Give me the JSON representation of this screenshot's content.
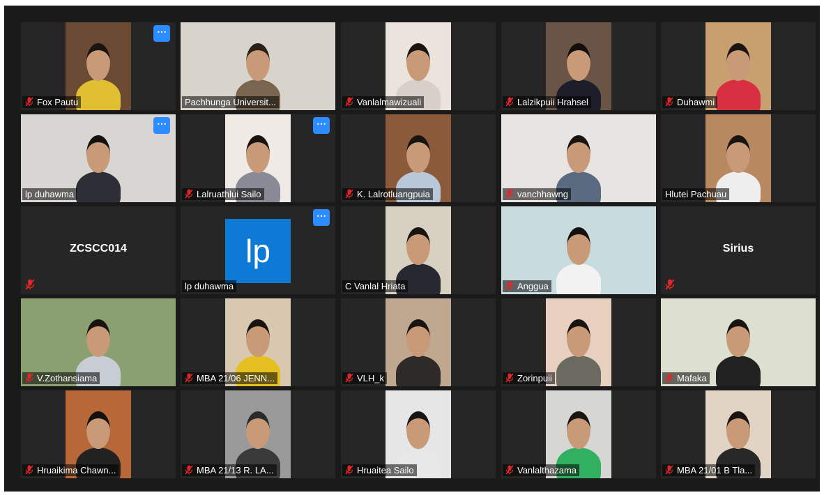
{
  "participants": [
    {
      "name": "Fox Pautu",
      "muted": true,
      "more": true,
      "bg": "#6b4a34",
      "shirt": "#e0c030",
      "hair": "#1a1410",
      "view": "center"
    },
    {
      "name": "Pachhunga Universit...",
      "muted": false,
      "more": false,
      "bg": "#d8d4cc",
      "shirt": "#7a6650",
      "hair": "#2a2018",
      "view": "full"
    },
    {
      "name": "Vanlalmawizuali",
      "muted": true,
      "more": false,
      "bg": "#ece4dc",
      "shirt": "#d8d0c8",
      "hair": "#1a1410",
      "view": "center"
    },
    {
      "name": "Lalzikpuii Hrahsel",
      "muted": true,
      "more": false,
      "bg": "#6a5446",
      "shirt": "#1e1e2a",
      "hair": "#140f0c",
      "view": "center"
    },
    {
      "name": "Duhawmi",
      "muted": true,
      "more": false,
      "bg": "#c8a070",
      "shirt": "#d83040",
      "hair": "#1a1410",
      "view": "center"
    },
    {
      "name": "lp duhawma",
      "muted": false,
      "more": true,
      "speaking": true,
      "bg": "#d8d6d2",
      "shirt": "#2e2e36",
      "hair": "#141010",
      "view": "full"
    },
    {
      "name": "Lalruathlui Sailo",
      "muted": true,
      "more": true,
      "bg": "#f0eae6",
      "shirt": "#8a8a96",
      "hair": "#1a1410",
      "view": "center"
    },
    {
      "name": "K. Lalrotluangpuia",
      "muted": true,
      "more": false,
      "bg": "#8a5a3a",
      "shirt": "#b8c8d8",
      "hair": "#1a1410",
      "view": "center"
    },
    {
      "name": "vanchhawng",
      "muted": true,
      "more": false,
      "bg": "#e8e4e2",
      "shirt": "#5a6a80",
      "hair": "#1a1410",
      "view": "full"
    },
    {
      "name": "Hlutei Pachuau",
      "muted": false,
      "more": false,
      "bg": "#b88860",
      "shirt": "#eeeeee",
      "hair": "#1a1410",
      "view": "center"
    },
    {
      "name": "",
      "title": "ZCSCC014",
      "muted": true,
      "more": false,
      "view": "name"
    },
    {
      "name": "lp duhawma",
      "muted": false,
      "more": true,
      "avatar": "lp",
      "view": "avatar"
    },
    {
      "name": "C Vanlal Hriata",
      "muted": false,
      "more": false,
      "bg": "#d8d0c0",
      "shirt": "#282830",
      "hair": "#1a1410",
      "view": "center"
    },
    {
      "name": "Anggua",
      "muted": true,
      "more": false,
      "bg": "#c8dce0",
      "shirt": "#f2f2f2",
      "hair": "#141010",
      "view": "full"
    },
    {
      "name": "",
      "title": "Sirius",
      "muted": true,
      "more": false,
      "view": "name"
    },
    {
      "name": "V.Zothansiama",
      "muted": true,
      "more": false,
      "bg": "#8aa070",
      "shirt": "#c8ccd4",
      "hair": "#1a1410",
      "view": "full"
    },
    {
      "name": "MBA 21/06 JENN...",
      "muted": true,
      "more": false,
      "bg": "#d8c8b0",
      "shirt": "#e6c020",
      "hair": "#1a1410",
      "view": "center"
    },
    {
      "name": "VLH_k",
      "muted": true,
      "more": false,
      "bg": "#c0a890",
      "shirt": "#2e2a28",
      "hair": "#1a1410",
      "view": "center"
    },
    {
      "name": "Zorinpuii",
      "muted": true,
      "more": false,
      "bg": "#e8d0c0",
      "shirt": "#6a6a60",
      "hair": "#1a1410",
      "view": "center"
    },
    {
      "name": "Mafaka",
      "muted": true,
      "more": false,
      "bg": "#dde0d0",
      "shirt": "#222222",
      "hair": "#1a1410",
      "view": "full"
    },
    {
      "name": "Hruaikima Chawn...",
      "muted": true,
      "more": false,
      "bg": "#b86838",
      "shirt": "#222222",
      "hair": "#141010",
      "view": "center"
    },
    {
      "name": "MBA 21/13 R. LA...",
      "muted": true,
      "more": false,
      "bg": "#9a9a9a",
      "shirt": "#3a3a3a",
      "hair": "#2a2a2a",
      "view": "center"
    },
    {
      "name": "Hruaitea Sailo",
      "muted": true,
      "more": false,
      "bg": "#e6e6e6",
      "shirt": "#e8e8e8",
      "hair": "#1a1410",
      "view": "center"
    },
    {
      "name": "Vanlalthazama",
      "muted": true,
      "more": false,
      "bg": "#d6d6d2",
      "shirt": "#30b060",
      "hair": "#1a1410",
      "view": "center"
    },
    {
      "name": "MBA 21/01 B Tla...",
      "muted": true,
      "more": false,
      "bg": "#e2d4c4",
      "shirt": "#282828",
      "hair": "#1a1410",
      "view": "center"
    }
  ],
  "colors": {
    "background": "#1a1a1a",
    "tile": "#262626",
    "active_speaker": "#c6e64d",
    "more_button": "#2d8cff",
    "mute_icon": "#e02828",
    "avatar": "#0d7ad6"
  }
}
